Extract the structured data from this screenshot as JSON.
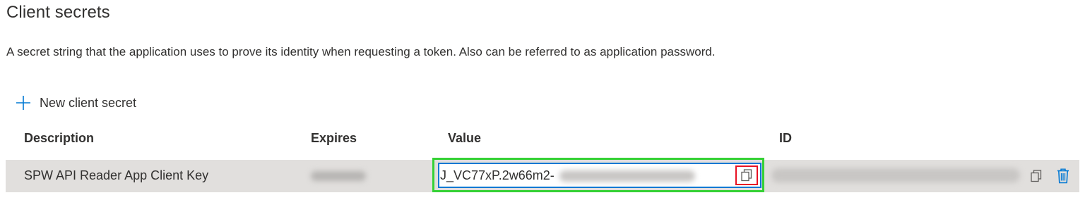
{
  "section": {
    "title": "Client secrets",
    "description": "A secret string that the application uses to prove its identity when requesting a token. Also can be referred to as application password."
  },
  "toolbar": {
    "new_secret_label": "New client secret",
    "new_secret_icon": "plus-icon"
  },
  "table": {
    "columns": [
      "Description",
      "Expires",
      "Value",
      "ID"
    ],
    "rows": [
      {
        "description": "SPW API Reader App Client Key",
        "expires": "",
        "value": "J_VC77xP.2w66m2-",
        "id": "",
        "actions": [
          "copy-icon",
          "trash-icon"
        ]
      }
    ]
  },
  "colors": {
    "accent": "#0078d4",
    "highlight_green": "#35d135",
    "highlight_red": "#e81123",
    "row_selected": "#e1dfdd"
  }
}
